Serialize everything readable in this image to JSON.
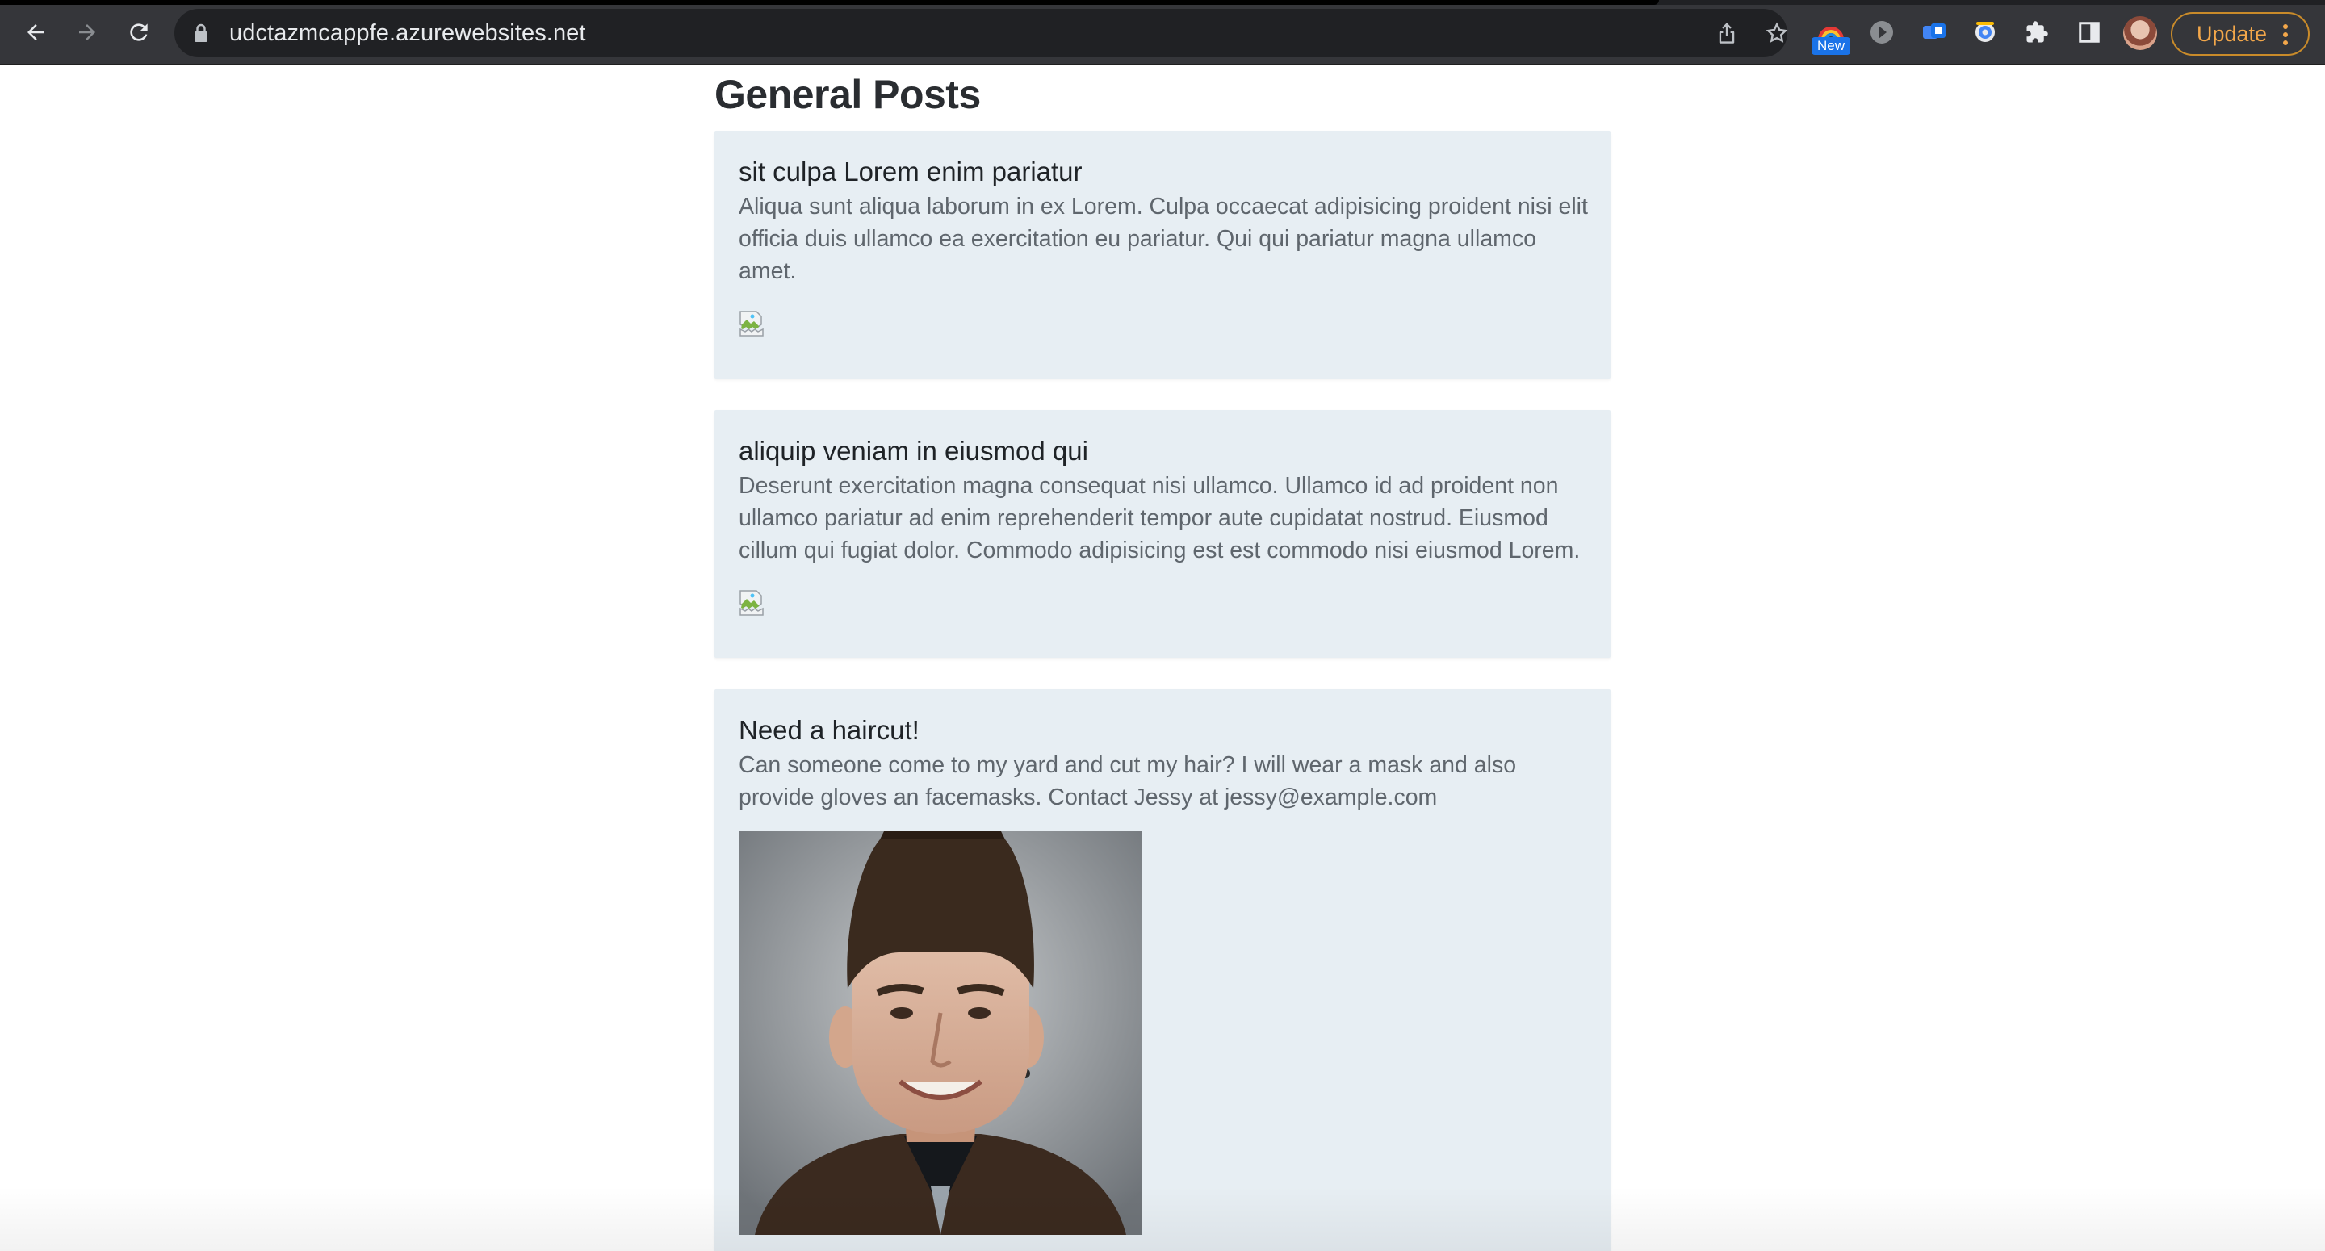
{
  "browser": {
    "url": "udctazmcappfe.azurewebsites.net",
    "new_badge": "New",
    "update_label": "Update",
    "icons": {
      "back": "arrow-left-icon",
      "forward": "arrow-right-icon",
      "reload": "reload-icon",
      "lock": "lock-icon",
      "share": "share-icon",
      "bookmark": "star-icon",
      "extensions": [
        "rainbow-extension-icon",
        "circle-extension-icon",
        "blue-square-extension-icon",
        "camera-extension-icon",
        "puzzle-icon"
      ],
      "side_panel": "side-panel-icon",
      "menu": "kebab-menu-icon"
    }
  },
  "page": {
    "heading": "General Posts",
    "colors": {
      "card_bg": "#e7eef3",
      "heading": "#2a2d31",
      "body_text": "#5f666d"
    },
    "posts": [
      {
        "title": "sit culpa Lorem enim pariatur",
        "body": "Aliqua sunt aliqua laborum in ex Lorem. Culpa occaecat adipisicing proident nisi elit officia duis ullamco ea exercitation eu pariatur. Qui qui pariatur magna ullamco amet.",
        "image": "broken-image-icon"
      },
      {
        "title": "aliquip veniam in eiusmod qui",
        "body": "Deserunt exercitation magna consequat nisi ullamco. Ullamco id ad proident non ullamco pariatur ad enim reprehenderit tempor aute cupidatat nostrud. Eiusmod cillum qui fugiat dolor. Commodo adipisicing est est commodo nisi eiusmod Lorem.",
        "image": "broken-image-icon"
      },
      {
        "title": "Need a haircut!",
        "body": "Can someone come to my yard and cut my hair? I will wear a mask and also provide gloves an facemasks. Contact Jessy at jessy@example.com",
        "image": "portrait-photo"
      }
    ]
  }
}
